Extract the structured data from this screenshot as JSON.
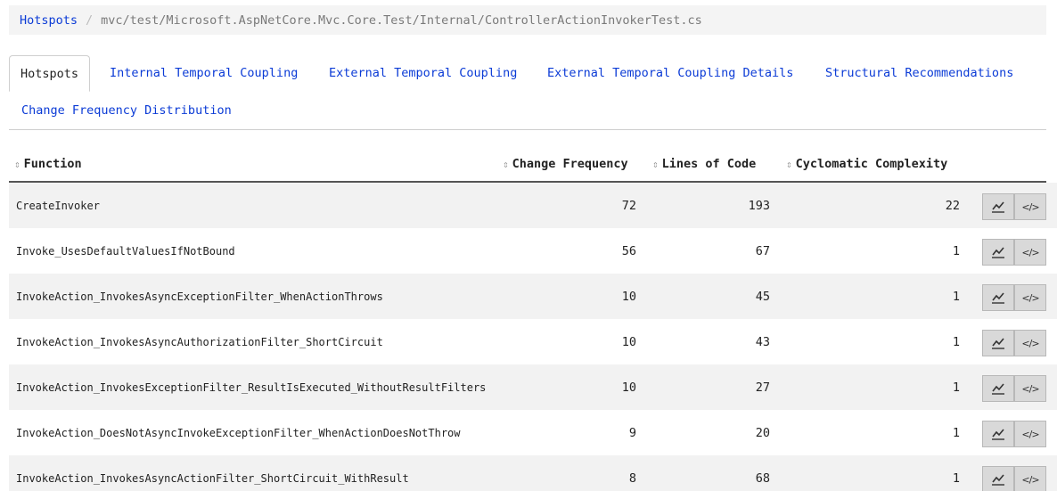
{
  "breadcrumb": {
    "root": "Hotspots",
    "separator": "/",
    "current": "mvc/test/Microsoft.AspNetCore.Mvc.Core.Test/Internal/ControllerActionInvokerTest.cs"
  },
  "tabs": [
    {
      "label": "Hotspots",
      "active": true
    },
    {
      "label": "Internal Temporal Coupling",
      "active": false
    },
    {
      "label": "External Temporal Coupling",
      "active": false
    },
    {
      "label": "External Temporal Coupling Details",
      "active": false
    },
    {
      "label": "Structural Recommendations",
      "active": false
    },
    {
      "label": "Change Frequency Distribution",
      "active": false
    }
  ],
  "table": {
    "sort_icon": "⇕",
    "columns": {
      "function": "Function",
      "change_frequency": "Change Frequency",
      "lines_of_code": "Lines of Code",
      "cyclomatic_complexity": "Cyclomatic Complexity"
    },
    "rows": [
      {
        "function": "CreateInvoker",
        "change_frequency": "72",
        "lines_of_code": "193",
        "cyclomatic_complexity": "22"
      },
      {
        "function": "Invoke_UsesDefaultValuesIfNotBound",
        "change_frequency": "56",
        "lines_of_code": "67",
        "cyclomatic_complexity": "1"
      },
      {
        "function": "InvokeAction_InvokesAsyncExceptionFilter_WhenActionThrows",
        "change_frequency": "10",
        "lines_of_code": "45",
        "cyclomatic_complexity": "1"
      },
      {
        "function": "InvokeAction_InvokesAsyncAuthorizationFilter_ShortCircuit",
        "change_frequency": "10",
        "lines_of_code": "43",
        "cyclomatic_complexity": "1"
      },
      {
        "function": "InvokeAction_InvokesExceptionFilter_ResultIsExecuted_WithoutResultFilters",
        "change_frequency": "10",
        "lines_of_code": "27",
        "cyclomatic_complexity": "1"
      },
      {
        "function": "InvokeAction_DoesNotAsyncInvokeExceptionFilter_WhenActionDoesNotThrow",
        "change_frequency": "9",
        "lines_of_code": "20",
        "cyclomatic_complexity": "1"
      },
      {
        "function": "InvokeAction_InvokesAsyncActionFilter_ShortCircuit_WithResult",
        "change_frequency": "8",
        "lines_of_code": "68",
        "cyclomatic_complexity": "1"
      }
    ],
    "row_actions": {
      "trend_icon": "line-chart-icon",
      "code_icon": "code-icon",
      "code_glyph": "</>"
    }
  },
  "colors": {
    "link": "#0b3bd6",
    "stripe": "#f2f2f2",
    "button": "#d9d9d9"
  }
}
